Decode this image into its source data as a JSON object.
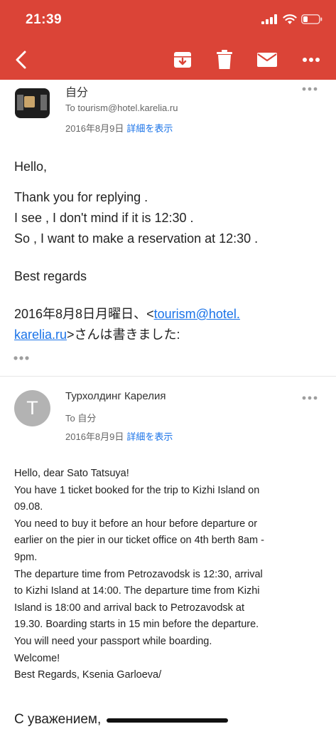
{
  "status_bar": {
    "time": "21:39"
  },
  "toolbar": {
    "icons": [
      "back-icon",
      "archive-icon",
      "trash-icon",
      "mail-icon",
      "more-icon"
    ]
  },
  "message1": {
    "sender": "自分",
    "to": "To tourism@hotel.karelia.ru",
    "date": "2016年8月9日",
    "details_link": "詳細を表示",
    "greeting": "Hello,",
    "line1": "Thank you for replying .",
    "line2": "I see , I don't mind if it is 12:30 .",
    "line3": "So , I want to make a reservation at 12:30 .",
    "closing": "Best regards",
    "quote_prefix": "2016年8月8日月曜日、<",
    "quote_email_part1": "tourism@hotel.",
    "quote_email_part2": "karelia.ru",
    "quote_suffix": ">さんは書きました:",
    "quote_more": "•••"
  },
  "message2": {
    "avatar_letter": "T",
    "sender": "Турхолдинг Карелия",
    "to": "To 自分",
    "date": "2016年8月9日",
    "details_link": "詳細を表示",
    "lines": [
      "Hello, dear Sato Tatsuya!",
      "You have 1 ticket booked for the trip to Kizhi Island on",
      "09.08.",
      "You need to buy it before an hour before departure or",
      "earlier on the pier in our ticket office on 4th berth 8am -",
      "9pm.",
      "The departure time from Petrozavodsk is 12:30, arrival",
      "to Kizhi Island at 14:00. The departure time from Kizhi",
      "Island is 18:00 and arrival back to Petrozavodsk at",
      "19.30. Boarding starts in 15 min before the departure.",
      "You will need your passport while boarding.",
      "Welcome!",
      "Best Regards, Ksenia Garloeva/"
    ],
    "signature": "С уважением,"
  },
  "colors": {
    "header_red": "#db4437",
    "link_blue": "#1a73e8"
  }
}
